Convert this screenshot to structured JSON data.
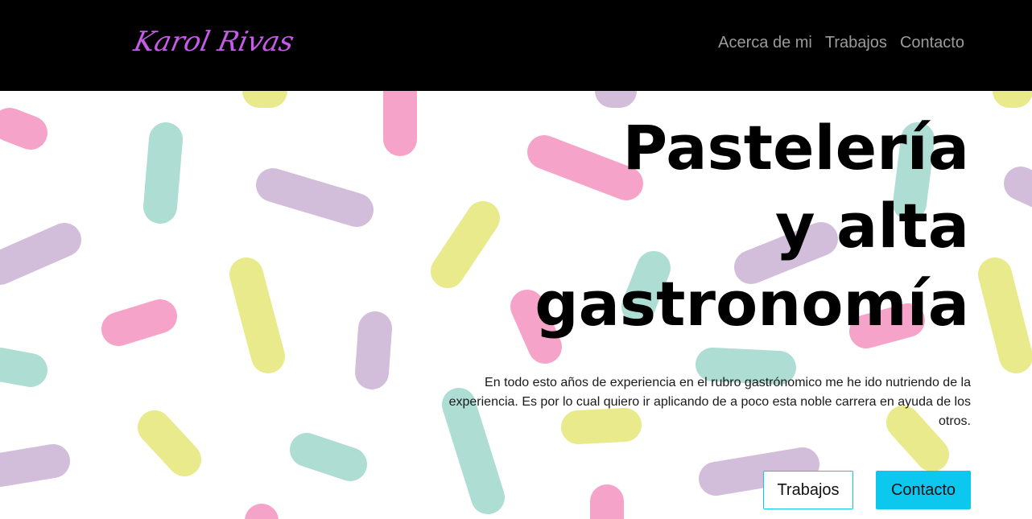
{
  "navbar": {
    "brand": "Karol Rivas",
    "links": [
      "Acerca de mi",
      "Trabajos",
      "Contacto"
    ]
  },
  "hero": {
    "title_lines": [
      "Pastelería",
      "y alta",
      "gastronomía"
    ],
    "description": "En todo esto años de experiencia en el rubro gastrónomico me he ido nutriendo de la experiencia. Es por lo cual quiero ir aplicando de a poco esta noble carrera en ayuda de los otros.",
    "buttons": {
      "primary_outline": "Trabajos",
      "primary_fill": "Contacto"
    }
  },
  "colors": {
    "brand": "#c55be6",
    "accent": "#0dc8ee",
    "sprinkle_pink": "#f5a3c8",
    "sprinkle_mint": "#aeddd3",
    "sprinkle_lilac": "#d2bddb",
    "sprinkle_yellow": "#e8ea8b"
  }
}
